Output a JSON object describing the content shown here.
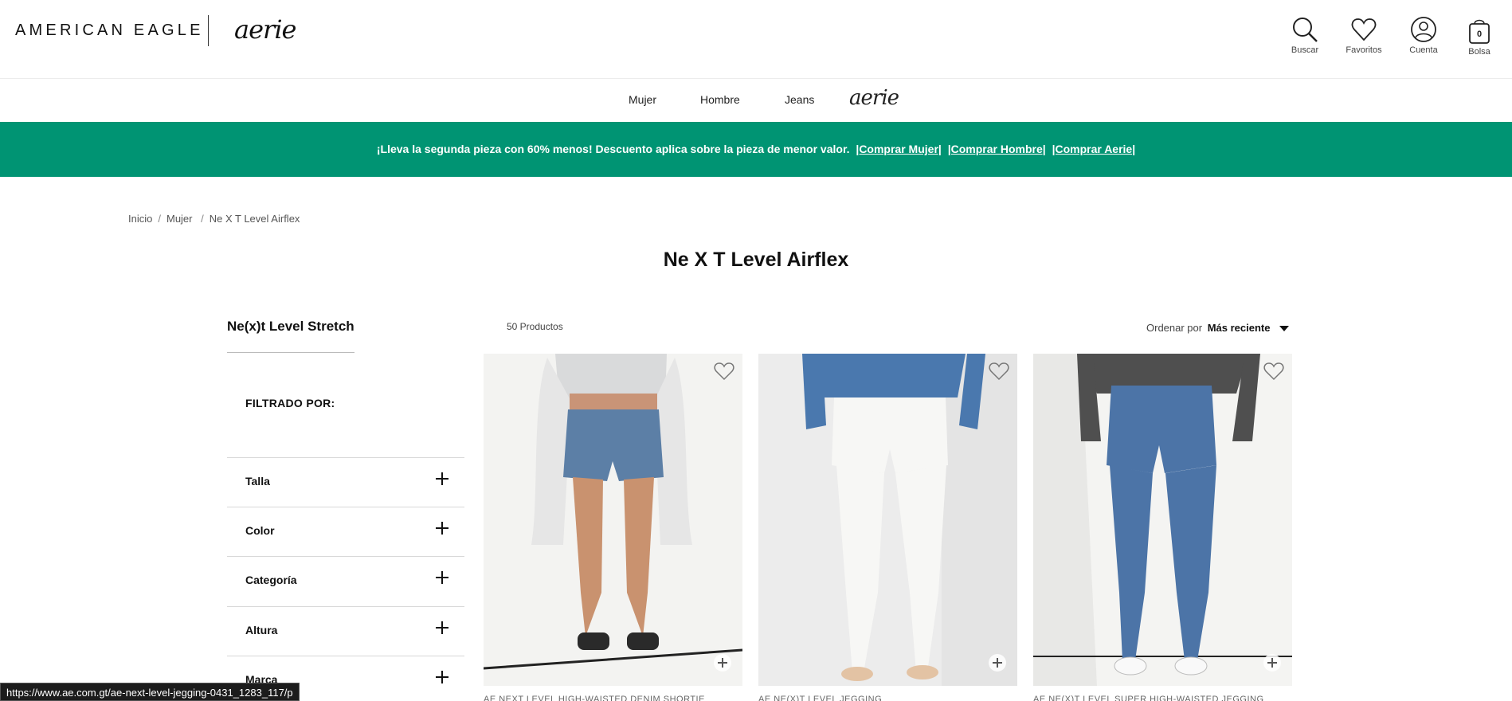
{
  "header": {
    "brand": "AMERICAN EAGLE",
    "sub_brand": "aerie",
    "utilities": [
      {
        "label": "Buscar",
        "icon": "search-icon"
      },
      {
        "label": "Favoritos",
        "icon": "heart-icon"
      },
      {
        "label": "Cuenta",
        "icon": "account-icon"
      },
      {
        "label": "Bolsa",
        "icon": "bag-icon",
        "count": "0"
      }
    ]
  },
  "nav": {
    "items": [
      "Mujer",
      "Hombre",
      "Jeans"
    ],
    "aerie": "aerie"
  },
  "promo": {
    "text": "¡Lleva la segunda pieza con 60% menos! Descuento aplica sobre la pieza de menor valor.",
    "links": [
      "|Comprar Mujer|",
      "|Comprar Hombre|",
      "|Comprar Aerie|"
    ],
    "background": "#009473"
  },
  "breadcrumb": [
    "Inicio",
    "Mujer",
    "Ne X T Level Airflex"
  ],
  "page_title": "Ne X T Level Airflex",
  "sidebar": {
    "category": "Ne(x)t Level Stretch",
    "filter_heading": "FILTRADO POR:",
    "facets": [
      "Talla",
      "Color",
      "Categoría",
      "Altura",
      "Marca"
    ]
  },
  "listing": {
    "count": "50 Productos",
    "sort_label": "Ordenar por",
    "sort_value": "Más reciente"
  },
  "products": [
    {
      "name": "AE NEXT LEVEL HIGH-WAISTED DENIM SHORTIE",
      "image": "denim shorts"
    },
    {
      "name": "AE NE(X)T LEVEL JEGGING",
      "image": "white jeggings"
    },
    {
      "name": "AE NE(X)T LEVEL SUPER HIGH-WAISTED JEGGING",
      "image": "blue jeggings"
    }
  ],
  "status_url": "https://www.ae.com.gt/ae-next-level-jegging-0431_1283_117/p"
}
